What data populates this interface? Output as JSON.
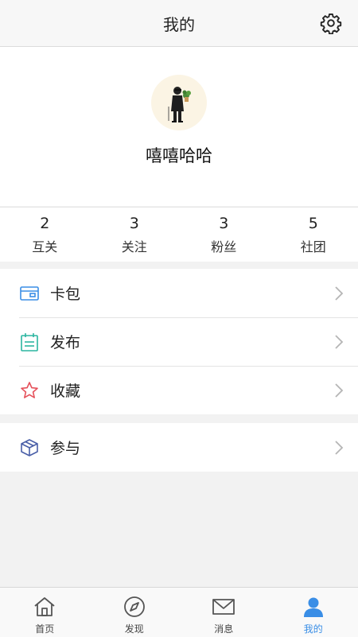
{
  "header": {
    "title": "我的"
  },
  "profile": {
    "username": "嘻嘻哈哈"
  },
  "stats": [
    {
      "count": "2",
      "label": "互关"
    },
    {
      "count": "3",
      "label": "关注"
    },
    {
      "count": "3",
      "label": "粉丝"
    },
    {
      "count": "5",
      "label": "社团"
    }
  ],
  "menu": {
    "wallet": "卡包",
    "publish": "发布",
    "favorites": "收藏",
    "participate": "参与"
  },
  "tabs": [
    {
      "label": "首页",
      "icon": "home-icon"
    },
    {
      "label": "发现",
      "icon": "compass-icon"
    },
    {
      "label": "消息",
      "icon": "mail-icon"
    },
    {
      "label": "我的",
      "icon": "user-icon"
    }
  ],
  "colors": {
    "accent": "#3a8ee6",
    "wallet_icon": "#3a8ee6",
    "publish_icon": "#2bb5a0",
    "favorites_icon": "#e5505a",
    "participate_icon": "#4a5fa8"
  }
}
